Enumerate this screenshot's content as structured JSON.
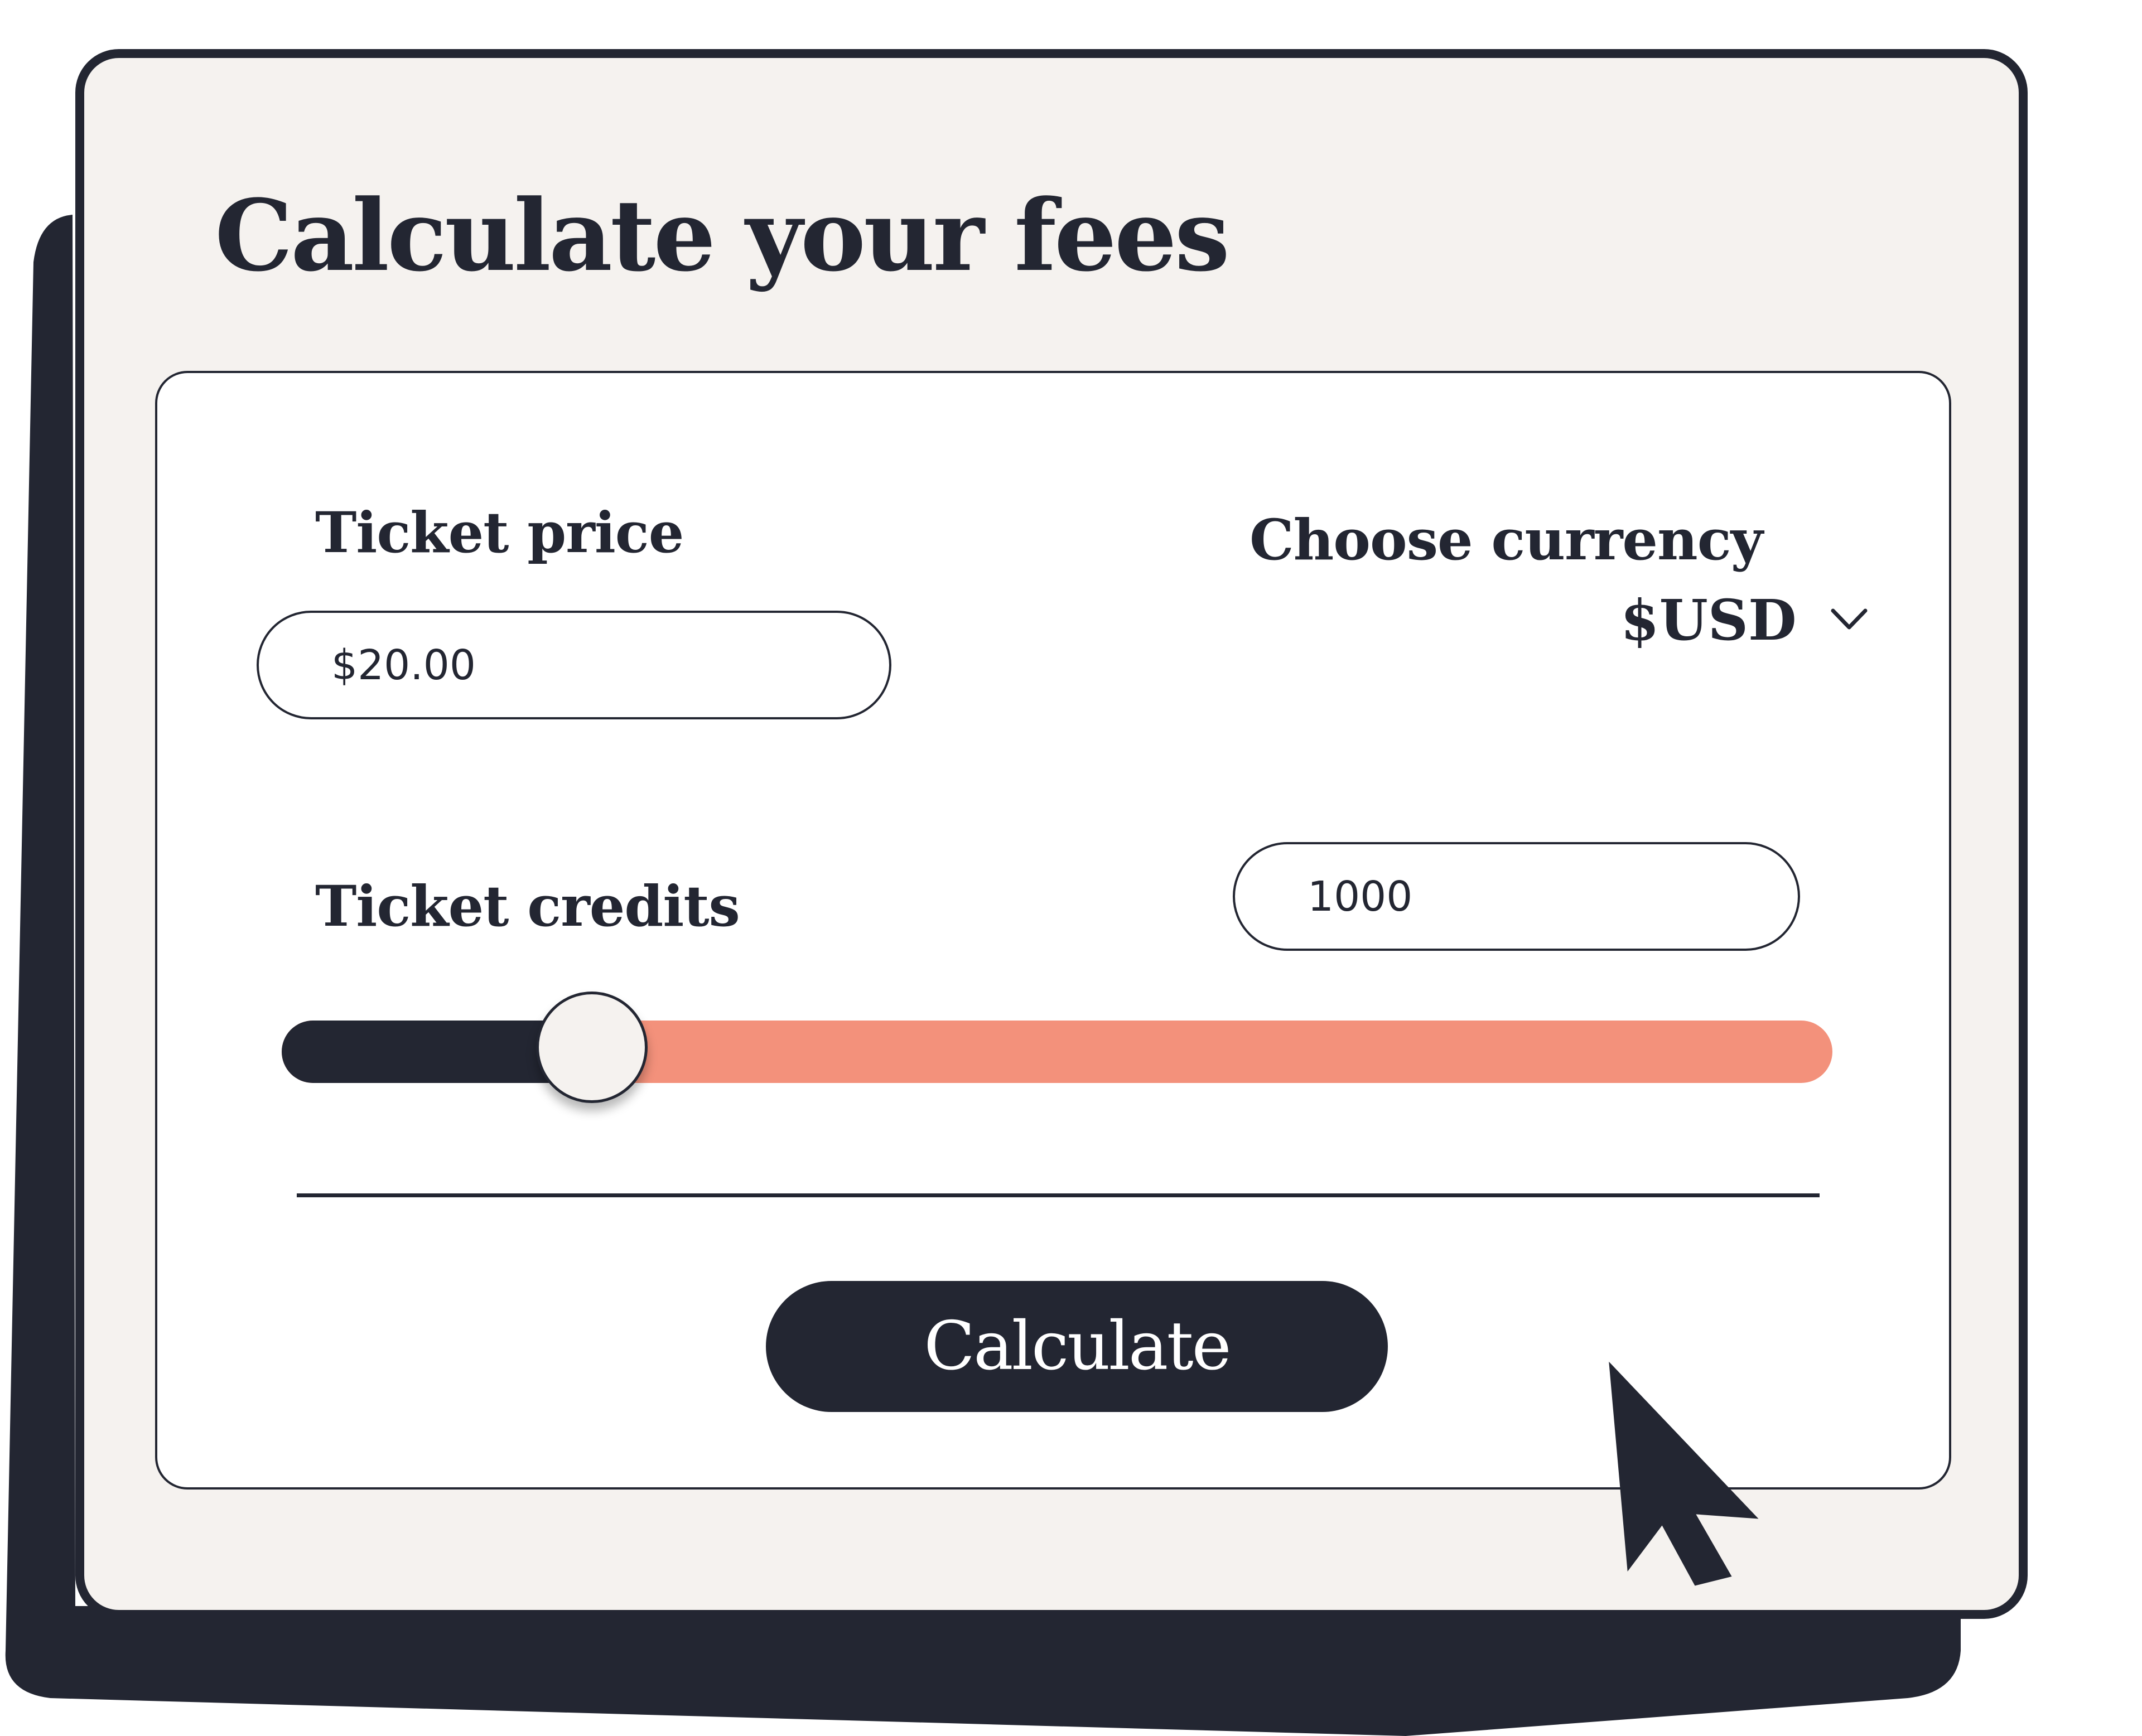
{
  "title": "Calculate your fees",
  "ticket_price": {
    "label": "Ticket price",
    "value": "$20.00"
  },
  "currency": {
    "label": "Choose currency",
    "selected": "$USD",
    "icon": "chevron-down-icon"
  },
  "ticket_credits": {
    "label": "Ticket credits",
    "value": "1000",
    "slider_fraction": 0.2
  },
  "calculate_button": {
    "label": "Calculate"
  },
  "pointer": {
    "icon": "mouse-pointer-icon"
  },
  "colors": {
    "ink": "#232632",
    "card_background": "#f5f2ef",
    "panel_background": "#ffffff",
    "slider_remaining": "#f3917b"
  }
}
